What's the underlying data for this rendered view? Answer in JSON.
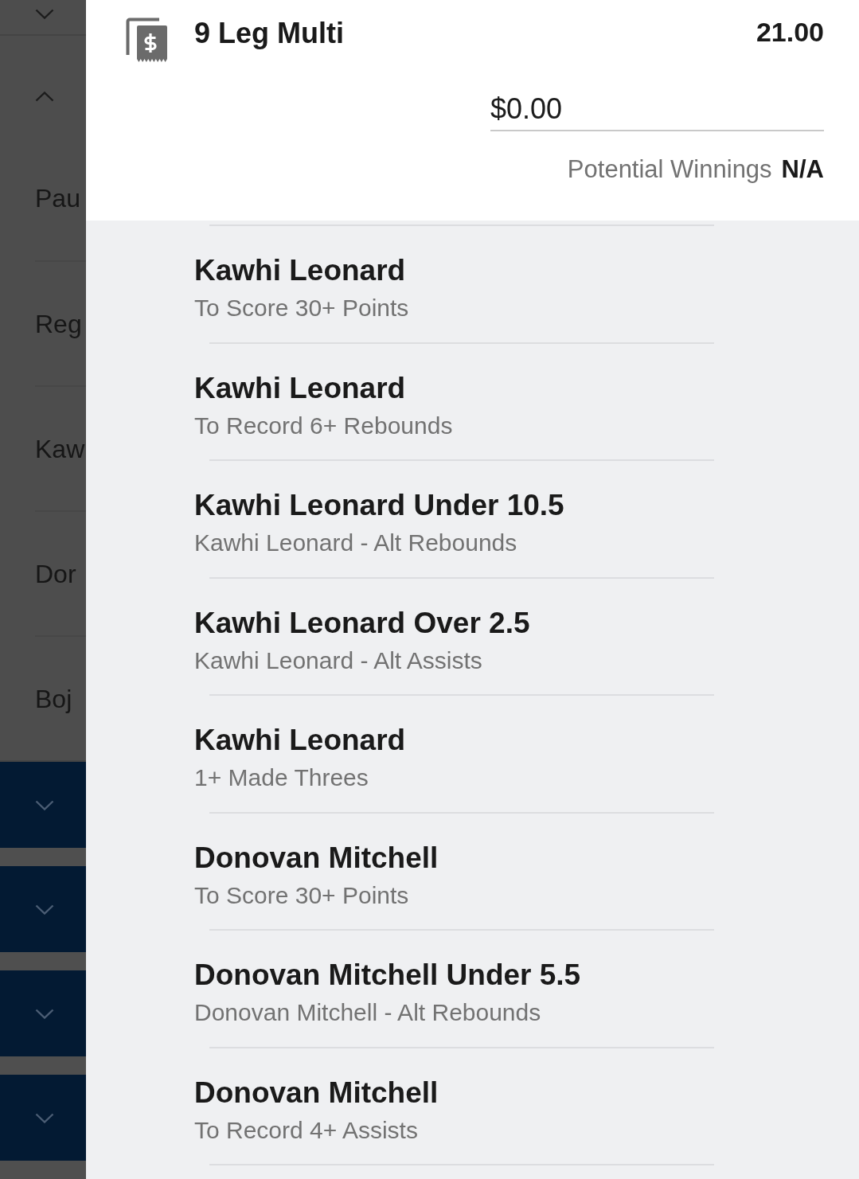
{
  "background_menu": {
    "groups": [
      {
        "kind": "plain",
        "expanded": false
      },
      {
        "kind": "plain",
        "expanded": true,
        "items": [
          "Pau",
          "Reg",
          "Kaw",
          "Dor",
          "Boj"
        ]
      },
      {
        "kind": "dark",
        "expanded": false
      },
      {
        "kind": "dark",
        "expanded": false
      },
      {
        "kind": "dark",
        "expanded": false
      },
      {
        "kind": "dark",
        "expanded": false
      }
    ]
  },
  "bet_slip": {
    "title": "9 Leg Multi",
    "odds": "21.00",
    "stake": {
      "value": "$0.00"
    },
    "potential_winnings": {
      "label": "Potential Winnings",
      "value": "N/A"
    },
    "legs": [
      {
        "selection": "Kawhi Leonard",
        "market": "To Score 30+ Points"
      },
      {
        "selection": "Kawhi Leonard",
        "market": "To Record 6+ Rebounds"
      },
      {
        "selection": "Kawhi Leonard Under 10.5",
        "market": "Kawhi Leonard - Alt Rebounds"
      },
      {
        "selection": "Kawhi Leonard Over 2.5",
        "market": "Kawhi Leonard - Alt Assists"
      },
      {
        "selection": "Kawhi Leonard",
        "market": "1+ Made Threes"
      },
      {
        "selection": "Donovan Mitchell",
        "market": "To Score 30+ Points"
      },
      {
        "selection": "Donovan Mitchell Under 5.5",
        "market": "Donovan Mitchell - Alt Rebounds"
      },
      {
        "selection": "Donovan Mitchell",
        "market": "To Record 4+ Assists"
      }
    ]
  }
}
